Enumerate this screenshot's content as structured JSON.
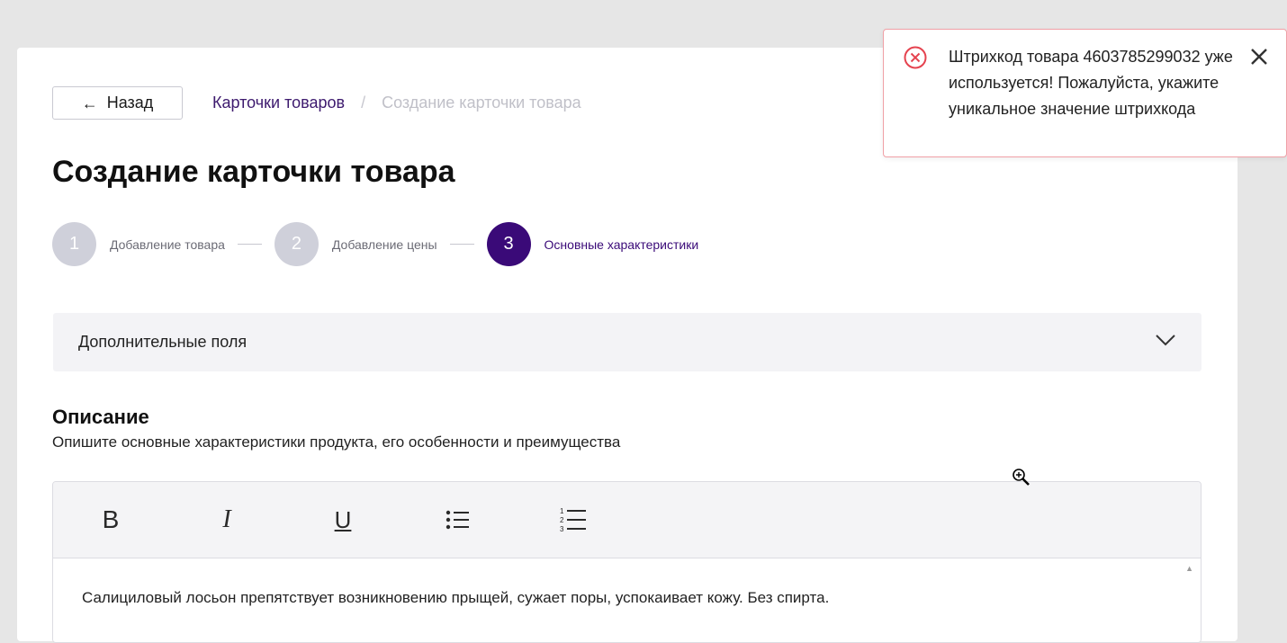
{
  "nav": {
    "back_label": "Назад",
    "breadcrumb": {
      "link": "Карточки товаров",
      "separator": "/",
      "current": "Создание карточки товара"
    }
  },
  "page_title": "Создание карточки товара",
  "stepper": {
    "steps": [
      {
        "number": "1",
        "label": "Добавление товара",
        "active": false
      },
      {
        "number": "2",
        "label": "Добавление цены",
        "active": false
      },
      {
        "number": "3",
        "label": "Основные характеристики",
        "active": true
      }
    ]
  },
  "accordion": {
    "label": "Дополнительные поля",
    "icon": "chevron-down-icon"
  },
  "description": {
    "title": "Описание",
    "subtitle": "Опишите основные характеристики продукта, его особенности и преимущества",
    "toolbar": {
      "bold_label": "B",
      "italic_label": "I",
      "underline_label": "U",
      "bullet_list_icon": "bullet-list-icon",
      "numbered_list_icon": "numbered-list-icon"
    },
    "text": "Салициловый лосьон препятствует возникновению прыщей, сужает поры, успокаивает кожу. Без спирта."
  },
  "toast": {
    "type": "error",
    "icon": "error-circle-icon",
    "message": "Штрихкод товара 4603785299032 уже используется! Пожалуйста, укажите уникальное значение штрихкода",
    "close_icon": "close-icon"
  },
  "colors": {
    "accent": "#3a0a78",
    "breadcrumb_link": "#3d1a6e",
    "step_inactive": "#cfd0da",
    "error": "#e5434f",
    "background": "#e6e6e6"
  }
}
